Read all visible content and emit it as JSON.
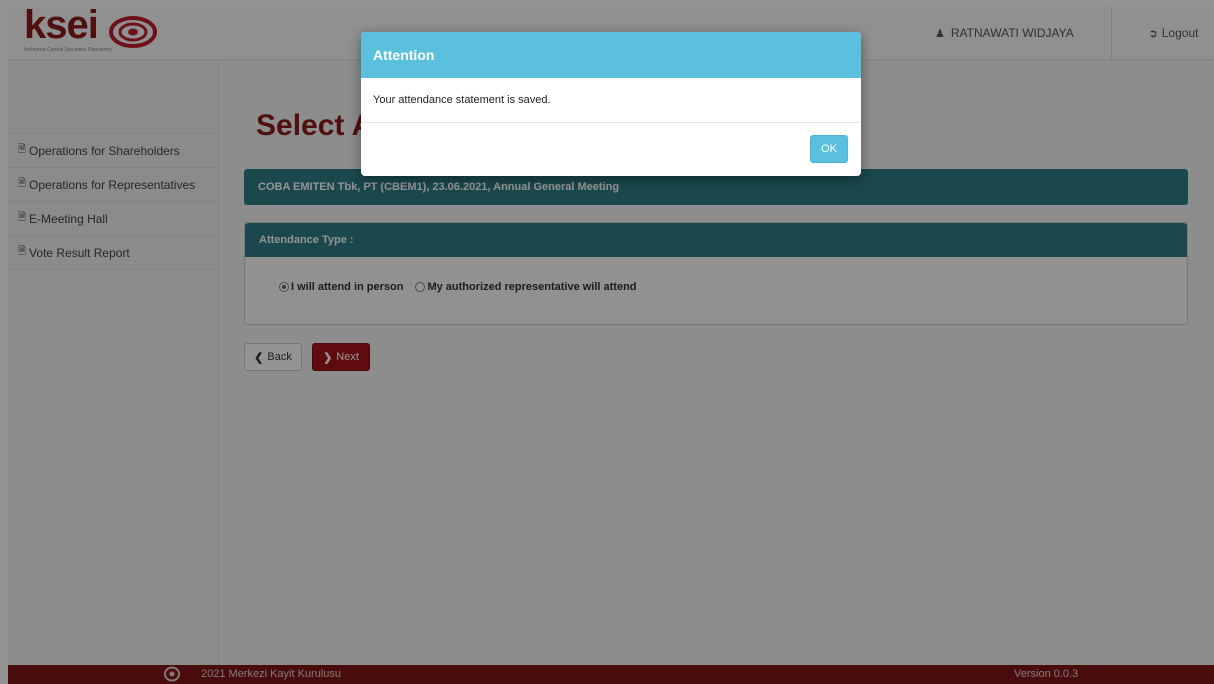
{
  "header": {
    "logo_text": "ksei",
    "logo_subtitle": "Indonesia Central Securities Depository",
    "user_name": "RATNAWATI WIDJAYA",
    "logout_label": "Logout"
  },
  "sidebar": {
    "items": [
      {
        "label": "Operations for Shareholders"
      },
      {
        "label": "Operations for Representatives"
      },
      {
        "label": "E-Meeting Hall"
      },
      {
        "label": "Vote Result Report"
      }
    ]
  },
  "main": {
    "title": "Select A",
    "event_title": "COBA EMITEN Tbk, PT (CBEM1), 23.06.2021, Annual General Meeting",
    "attendance_header": "Attendance Type :",
    "options": [
      {
        "label": "I will attend in person",
        "selected": true
      },
      {
        "label": "My authorized representative will attend",
        "selected": false
      }
    ],
    "back_label": "Back",
    "next_label": "Next"
  },
  "footer": {
    "copyright": "2021 Merkezi Kayit Kurulusu",
    "version": "Version 0.0.3"
  },
  "modal": {
    "title": "Attention",
    "message": "Your attendance statement is saved.",
    "ok_label": "OK"
  },
  "colors": {
    "brand": "#8a1c1c",
    "panel": "#2e7c84",
    "modal_accent": "#5bc0de",
    "next_button": "#a5151b"
  }
}
